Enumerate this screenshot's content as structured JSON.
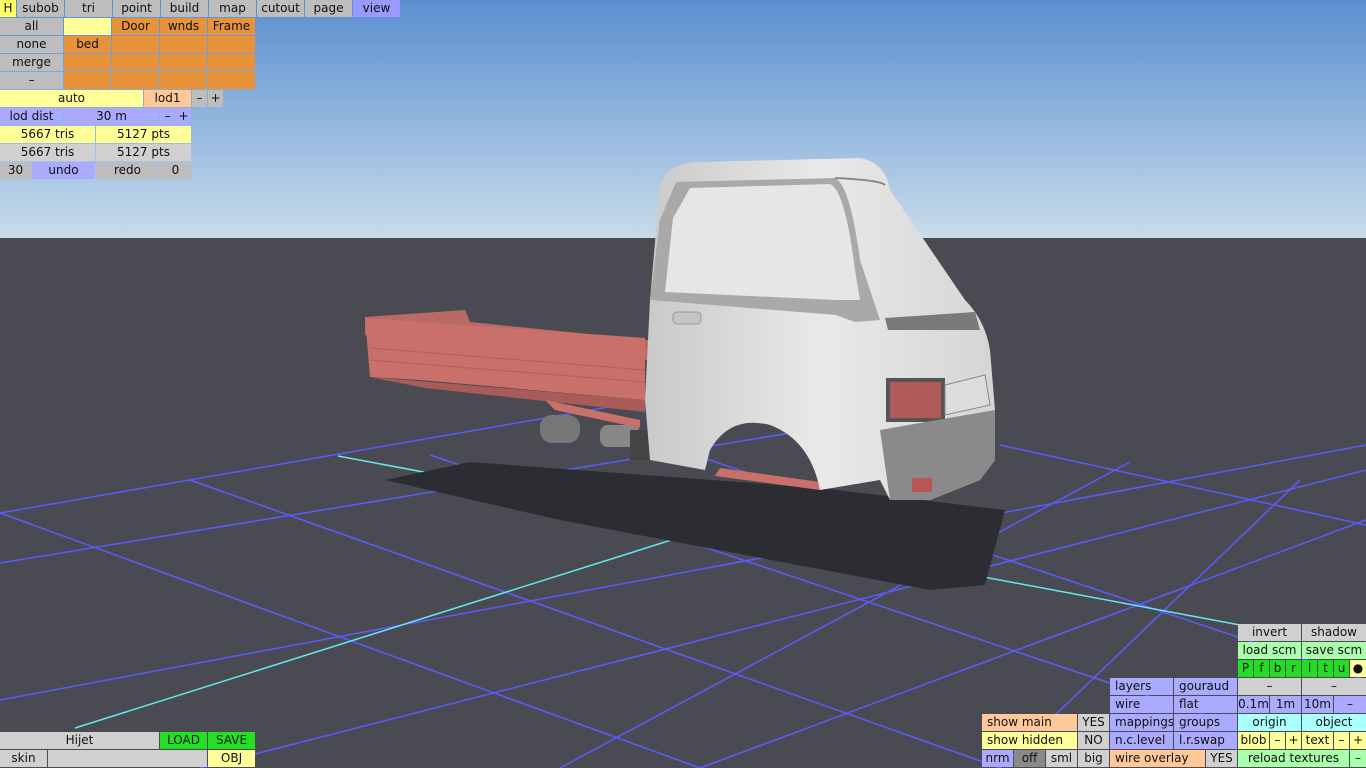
{
  "top_menu": {
    "h": "H",
    "items": [
      "subob",
      "tri",
      "point",
      "build",
      "map",
      "cutout",
      "page",
      "view"
    ]
  },
  "subobj": {
    "all": "all",
    "none": "none",
    "merge": "merge",
    "minus": "–",
    "door": "Door",
    "wnds": "wnds",
    "frame": "Frame",
    "bed": "bed"
  },
  "lod": {
    "auto": "auto",
    "level": "lod1",
    "minus": "–",
    "plus": "+",
    "dist_label": "lod dist",
    "dist_value": "30 m"
  },
  "stats": {
    "tris_1": "5667 tris",
    "pts_1": "5127 pts",
    "tris_2": "5667 tris",
    "pts_2": "5127 pts"
  },
  "history": {
    "count": "30",
    "undo": "undo",
    "redo": "redo",
    "redo_count": "0"
  },
  "bottom_left": {
    "name": "Hijet",
    "load": "LOAD",
    "save": "SAVE",
    "skin": "skin",
    "obj": "OBJ"
  },
  "view_opts": {
    "show_main": "show main",
    "show_main_val": "YES",
    "show_hidden": "show hidden",
    "show_hidden_val": "NO",
    "nrm": "nrm",
    "off": "off",
    "sml": "sml",
    "big": "big"
  },
  "render": {
    "layers": "layers",
    "gouraud": "gouraud",
    "wire": "wire",
    "flat": "flat",
    "mappings": "mappings",
    "groups": "groups",
    "nc_level": "n.c.level",
    "lr_swap": "l.r.swap",
    "wire_overlay": "wire overlay",
    "wire_overlay_val": "YES"
  },
  "right_panel": {
    "invert": "invert",
    "shadow": "shadow",
    "load_scm": "load scm",
    "save_scm": "save scm",
    "flags": [
      "P",
      "f",
      "b",
      "r",
      "l",
      "t",
      "u",
      "●"
    ],
    "dash1": "–",
    "dash2": "–",
    "s01": "0.1m",
    "s1": "1m",
    "s10": "10m",
    "sminus": "–",
    "origin": "origin",
    "object": "object",
    "blob": "blob",
    "blob_minus": "–",
    "blob_plus": "+",
    "text": "text",
    "text_minus": "–",
    "text_plus": "+",
    "reload": "reload textures",
    "reload_minus": "–"
  },
  "colors": {
    "sky_top": "#5a8fd0",
    "sky_bottom": "#c9dceb",
    "ground": "#4a4b52",
    "grid": "#5b5bff",
    "axis": "#66e6f0",
    "cab": "#dedede",
    "bed": "#c9706a"
  }
}
